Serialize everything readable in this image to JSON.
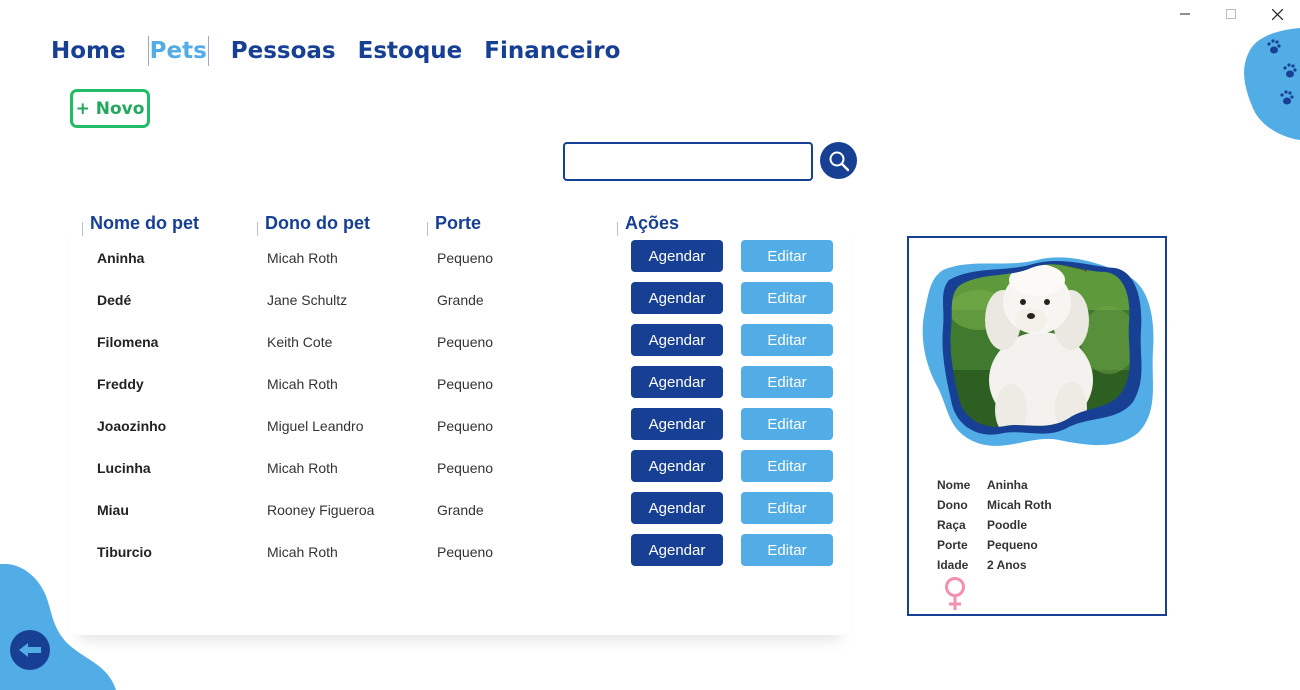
{
  "window": {
    "minimize_icon": "minimize-icon",
    "maximize_icon": "maximize-icon",
    "close_icon": "close-icon"
  },
  "nav": {
    "items": [
      {
        "label": "Home",
        "active": false
      },
      {
        "label": "Pets",
        "active": true
      },
      {
        "label": "Pessoas",
        "active": false
      },
      {
        "label": "Estoque",
        "active": false
      },
      {
        "label": "Financeiro",
        "active": false
      }
    ]
  },
  "toolbar": {
    "new_label": "+ Novo"
  },
  "search": {
    "value": "",
    "placeholder": "",
    "icon": "search-icon"
  },
  "table": {
    "headers": {
      "name": "Nome do pet",
      "owner": "Dono do pet",
      "size": "Porte",
      "actions": "Ações"
    },
    "schedule_label": "Agendar",
    "edit_label": "Editar",
    "rows": [
      {
        "name": "Aninha",
        "owner": "Micah Roth",
        "size": "Pequeno"
      },
      {
        "name": "Dedé",
        "owner": "Jane Schultz",
        "size": "Grande"
      },
      {
        "name": "Filomena",
        "owner": "Keith Cote",
        "size": "Pequeno"
      },
      {
        "name": "Freddy",
        "owner": "Micah Roth",
        "size": "Pequeno"
      },
      {
        "name": "Joaozinho",
        "owner": "Miguel Leandro",
        "size": "Pequeno"
      },
      {
        "name": "Lucinha",
        "owner": "Micah Roth",
        "size": "Pequeno"
      },
      {
        "name": "Miau",
        "owner": "Rooney Figueroa",
        "size": "Grande"
      },
      {
        "name": "Tiburcio",
        "owner": "Micah Roth",
        "size": "Pequeno"
      }
    ]
  },
  "detail": {
    "labels": {
      "name": "Nome",
      "owner": "Dono",
      "breed": "Raça",
      "size": "Porte",
      "age": "Idade"
    },
    "values": {
      "name": "Aninha",
      "owner": "Micah Roth",
      "breed": "Poodle",
      "size": "Pequeno",
      "age": "2 Anos"
    },
    "gender_icon": "female-icon",
    "photo": "poodle-photo"
  },
  "colors": {
    "primary": "#173f93",
    "accent": "#52ade6",
    "new_button": "#22bb66",
    "female": "#f48fb1"
  },
  "back_icon": "arrow-left-icon"
}
